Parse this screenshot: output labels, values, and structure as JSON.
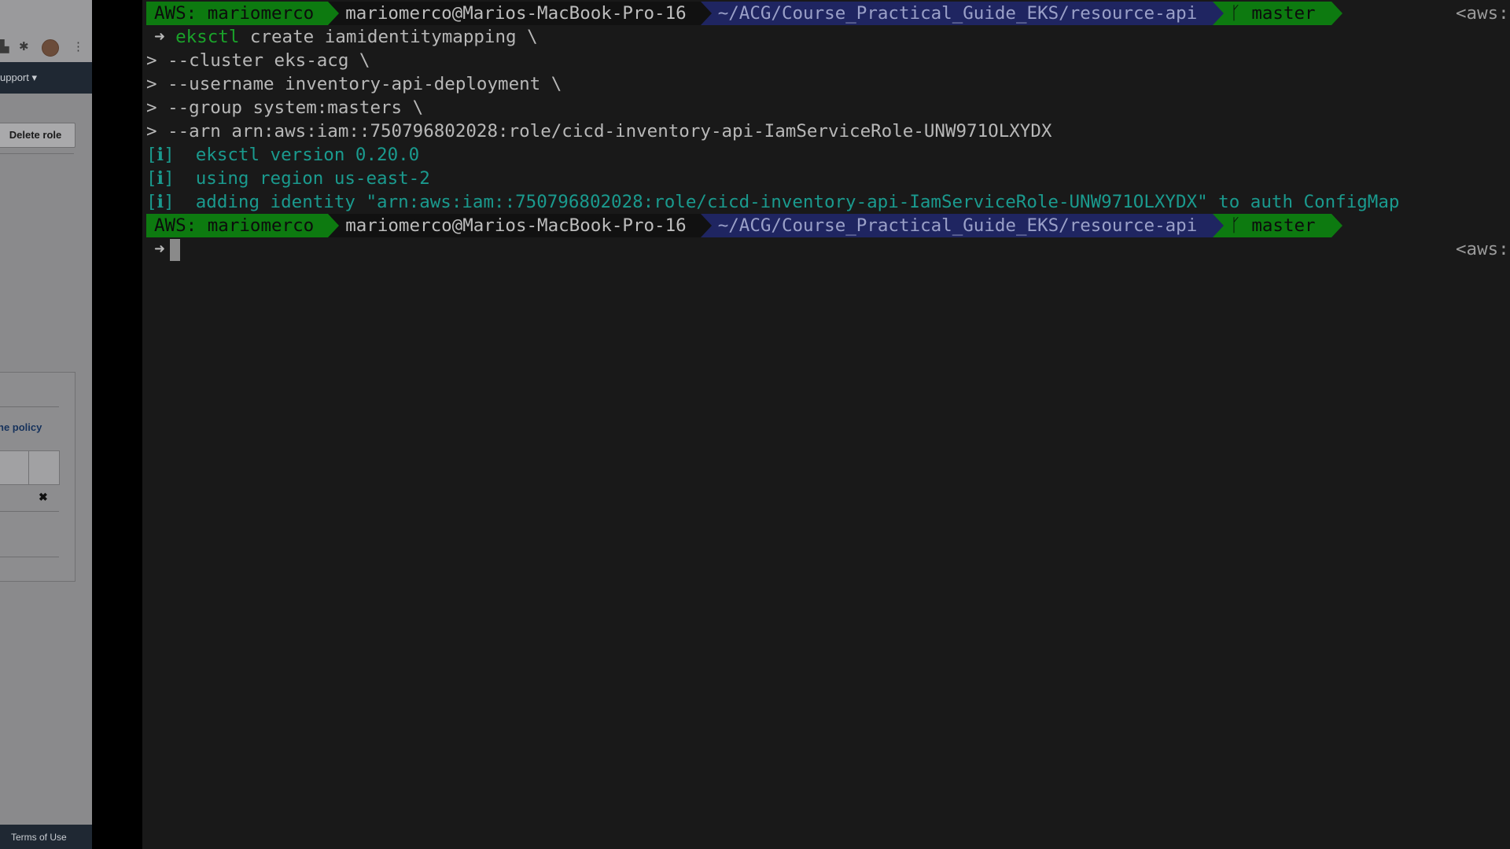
{
  "browser": {
    "nav_label": "upport",
    "delete_role_label": "Delete role",
    "inline_policy_link": "ne policy",
    "close_label": "✖",
    "footer_label": "Terms of Use"
  },
  "terminal": {
    "prompt": {
      "aws_segment": "AWS: mariomerco",
      "user_segment": "mariomerco@Marios-MacBook-Pro-16",
      "dir_segment": "~/ACG/Course_Practical_Guide_EKS/resource-api",
      "git_segment": "master",
      "git_icon": "branch-icon",
      "right_prompt": "<aws:"
    },
    "command": {
      "arrow": "➜",
      "program": "eksctl",
      "args": " create iamidentitymapping \\"
    },
    "continuation_lines": [
      "> --cluster eks-acg \\",
      "> --username inventory-api-deployment \\",
      "> --group system:masters \\",
      "> --arn arn:aws:iam::750796802028:role/cicd-inventory-api-IamServiceRole-UNW971OLXYDX"
    ],
    "output_lines": [
      "[ℹ]  eksctl version 0.20.0",
      "[ℹ]  using region us-east-2",
      "[ℹ]  adding identity \"arn:aws:iam::750796802028:role/cicd-inventory-api-IamServiceRole-UNW971OLXYDX\" to auth ConfigMap"
    ],
    "second_prompt_arrow": "➜"
  },
  "colors": {
    "terminal_bg": "#191919",
    "aws_segment_bg": "#0d7a10",
    "dir_segment_bg": "#1f2561",
    "output_teal": "#1a9a8e",
    "command_green": "#1aa32a"
  }
}
